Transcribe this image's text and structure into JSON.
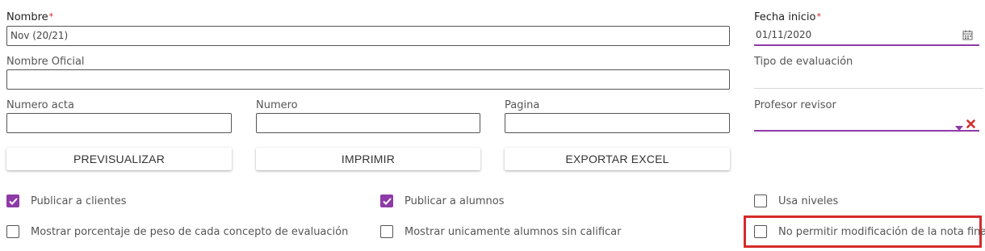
{
  "form": {
    "nombre": {
      "label": "Nombre",
      "required": "*",
      "value": "Nov (20/21)"
    },
    "nombre_oficial": {
      "label": "Nombre Oficial",
      "value": ""
    },
    "numero_acta": {
      "label": "Numero acta",
      "value": ""
    },
    "numero": {
      "label": "Numero",
      "value": ""
    },
    "pagina": {
      "label": "Pagina",
      "value": ""
    },
    "fecha_inicio": {
      "label": "Fecha inicio",
      "required": "*",
      "value": "01/11/2020",
      "icon": "calendar-icon"
    },
    "tipo_evaluacion": {
      "label": "Tipo de evaluación",
      "value": ""
    },
    "profesor_revisor": {
      "label": "Profesor revisor",
      "value": "",
      "dropdown_icon": "caret-down-icon",
      "clear_icon": "close-icon"
    }
  },
  "buttons": {
    "previsualizar": "PREVISUALIZAR",
    "imprimir": "IMPRIMIR",
    "exportar_excel": "EXPORTAR EXCEL"
  },
  "checkboxes": {
    "publicar_clientes": {
      "label": "Publicar a clientes",
      "checked": true
    },
    "publicar_alumnos": {
      "label": "Publicar a alumnos",
      "checked": true
    },
    "usa_niveles": {
      "label": "Usa niveles",
      "checked": false
    },
    "mostrar_porcentaje": {
      "label": "Mostrar porcentaje de peso de cada concepto de evaluación",
      "checked": false
    },
    "mostrar_sin_calificar": {
      "label": "Mostrar unicamente alumnos sin calificar",
      "checked": false
    },
    "no_permitir_modificacion": {
      "label": "No permitir modificación de la nota final",
      "checked": false
    }
  },
  "colors": {
    "accent": "#8e3aa7",
    "required": "#c62828",
    "highlight": "#d62b2b",
    "clear": "#d32f2f"
  }
}
